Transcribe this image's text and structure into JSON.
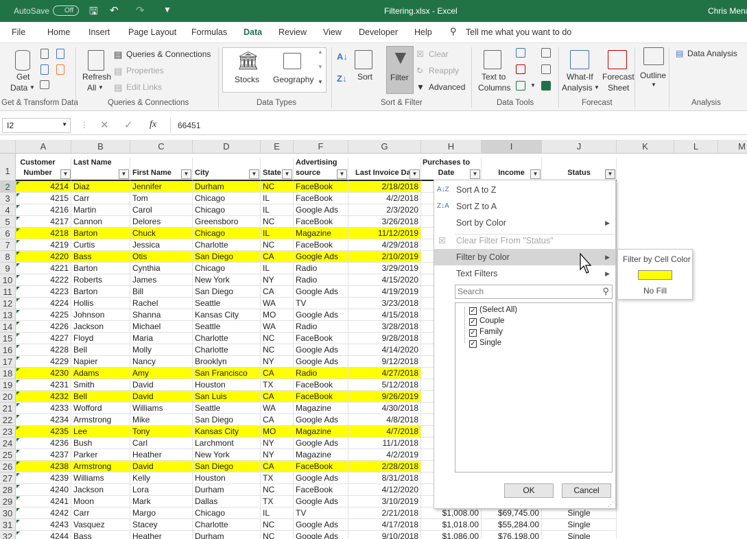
{
  "titlebar": {
    "autosave": "AutoSave",
    "autosave_state": "Off",
    "filename": "Filtering.xlsx  -  Excel",
    "user": "Chris Menard"
  },
  "tabs": [
    "File",
    "Home",
    "Insert",
    "Page Layout",
    "Formulas",
    "Data",
    "Review",
    "View",
    "Developer",
    "Help"
  ],
  "tell_me": "Tell me what you want to do",
  "ribbon": {
    "get_data": [
      "Get",
      "Data"
    ],
    "refresh": [
      "Refresh",
      "All"
    ],
    "queries_connections": "Queries & Connections",
    "properties": "Properties",
    "edit_links": "Edit Links",
    "stocks": "Stocks",
    "geography": "Geography",
    "sort": "Sort",
    "filter": "Filter",
    "clear": "Clear",
    "reapply": "Reapply",
    "advanced": "Advanced",
    "text_to_columns": [
      "Text to",
      "Columns"
    ],
    "what_if": [
      "What-If",
      "Analysis"
    ],
    "forecast_sheet": [
      "Forecast",
      "Sheet"
    ],
    "outline": "Outline",
    "data_analysis": "Data Analysis",
    "groups": [
      "Get & Transform Data",
      "Queries & Connections",
      "Data Types",
      "Sort & Filter",
      "Data Tools",
      "Forecast",
      "Analysis"
    ]
  },
  "formula_bar": {
    "name_box": "I2",
    "value": "66451"
  },
  "columns": [
    "A",
    "B",
    "C",
    "D",
    "E",
    "F",
    "G",
    "H",
    "I",
    "J",
    "K",
    "L",
    "M"
  ],
  "headers": {
    "A": [
      "Customer",
      "Number"
    ],
    "B": [
      "",
      "Last Name"
    ],
    "C": [
      "",
      "First Name"
    ],
    "D": [
      "",
      "City"
    ],
    "E": [
      "",
      "State"
    ],
    "F": [
      "Advertising",
      "source"
    ],
    "G": [
      "",
      "Last Invoice Dat"
    ],
    "H": [
      "Purchases to",
      "Date"
    ],
    "I": [
      "",
      "Income"
    ],
    "J": [
      "",
      "Status"
    ]
  },
  "rows": [
    {
      "n": "2",
      "hl": true,
      "a": "4214",
      "b": "Diaz",
      "c": "Jennifer",
      "d": "Durham",
      "e": "NC",
      "f": "FaceBook",
      "g": "2/18/2018"
    },
    {
      "n": "3",
      "hl": false,
      "a": "4215",
      "b": "Carr",
      "c": "Tom",
      "d": "Chicago",
      "e": "IL",
      "f": "FaceBook",
      "g": "4/2/2018"
    },
    {
      "n": "4",
      "hl": false,
      "a": "4216",
      "b": "Martin",
      "c": "Carol",
      "d": "Chicago",
      "e": "IL",
      "f": "Google Ads",
      "g": "2/3/2020"
    },
    {
      "n": "5",
      "hl": false,
      "a": "4217",
      "b": "Cannon",
      "c": "Delores",
      "d": "Greensboro",
      "e": "NC",
      "f": "FaceBook",
      "g": "3/26/2018"
    },
    {
      "n": "6",
      "hl": true,
      "a": "4218",
      "b": "Barton",
      "c": "Chuck",
      "d": "Chicago",
      "e": "IL",
      "f": "Magazine",
      "g": "11/12/2019"
    },
    {
      "n": "7",
      "hl": false,
      "a": "4219",
      "b": "Curtis",
      "c": "Jessica",
      "d": "Charlotte",
      "e": "NC",
      "f": "FaceBook",
      "g": "4/29/2018"
    },
    {
      "n": "8",
      "hl": true,
      "a": "4220",
      "b": "Bass",
      "c": "Otis",
      "d": "San Diego",
      "e": "CA",
      "f": "Google Ads",
      "g": "2/10/2019"
    },
    {
      "n": "9",
      "hl": false,
      "a": "4221",
      "b": "Barton",
      "c": "Cynthia",
      "d": "Chicago",
      "e": "IL",
      "f": "Radio",
      "g": "3/29/2019"
    },
    {
      "n": "10",
      "hl": false,
      "a": "4222",
      "b": "Roberts",
      "c": "James",
      "d": "New York",
      "e": "NY",
      "f": "Radio",
      "g": "4/15/2020"
    },
    {
      "n": "11",
      "hl": false,
      "a": "4223",
      "b": "Barton",
      "c": "Bill",
      "d": "San Diego",
      "e": "CA",
      "f": "Google Ads",
      "g": "4/19/2019"
    },
    {
      "n": "12",
      "hl": false,
      "a": "4224",
      "b": "Hollis",
      "c": "Rachel",
      "d": "Seattle",
      "e": "WA",
      "f": "TV",
      "g": "3/23/2018"
    },
    {
      "n": "13",
      "hl": false,
      "a": "4225",
      "b": "Johnson",
      "c": "Shanna",
      "d": "Kansas City",
      "e": "MO",
      "f": "Google Ads",
      "g": "4/15/2018"
    },
    {
      "n": "14",
      "hl": false,
      "a": "4226",
      "b": "Jackson",
      "c": "Michael",
      "d": "Seattle",
      "e": "WA",
      "f": "Radio",
      "g": "3/28/2018"
    },
    {
      "n": "15",
      "hl": false,
      "a": "4227",
      "b": "Floyd",
      "c": "Maria",
      "d": "Charlotte",
      "e": "NC",
      "f": "FaceBook",
      "g": "9/28/2018"
    },
    {
      "n": "16",
      "hl": false,
      "a": "4228",
      "b": "Bell",
      "c": "Molly",
      "d": "Charlotte",
      "e": "NC",
      "f": "Google Ads",
      "g": "4/14/2020"
    },
    {
      "n": "17",
      "hl": false,
      "a": "4229",
      "b": "Napier",
      "c": "Nancy",
      "d": "Brooklyn",
      "e": "NY",
      "f": "Google Ads",
      "g": "9/12/2018"
    },
    {
      "n": "18",
      "hl": true,
      "a": "4230",
      "b": "Adams",
      "c": "Amy",
      "d": "San Francisco",
      "e": "CA",
      "f": "Radio",
      "g": "4/27/2018"
    },
    {
      "n": "19",
      "hl": false,
      "a": "4231",
      "b": "Smith",
      "c": "David",
      "d": "Houston",
      "e": "TX",
      "f": "FaceBook",
      "g": "5/12/2018"
    },
    {
      "n": "20",
      "hl": true,
      "a": "4232",
      "b": "Bell",
      "c": "David",
      "d": "San Luis",
      "e": "CA",
      "f": "FaceBook",
      "g": "9/26/2019"
    },
    {
      "n": "21",
      "hl": false,
      "a": "4233",
      "b": "Wofford",
      "c": "Williams",
      "d": "Seattle",
      "e": "WA",
      "f": "Magazine",
      "g": "4/30/2018"
    },
    {
      "n": "22",
      "hl": false,
      "a": "4234",
      "b": "Armstrong",
      "c": "Mike",
      "d": "San Diego",
      "e": "CA",
      "f": "Google Ads",
      "g": "4/8/2018"
    },
    {
      "n": "23",
      "hl": true,
      "a": "4235",
      "b": "Lee",
      "c": "Tony",
      "d": "Kansas City",
      "e": "MO",
      "f": "Magazine",
      "g": "4/7/2018"
    },
    {
      "n": "24",
      "hl": false,
      "a": "4236",
      "b": "Bush",
      "c": "Carl",
      "d": "Larchmont",
      "e": "NY",
      "f": "Google Ads",
      "g": "11/1/2018"
    },
    {
      "n": "25",
      "hl": false,
      "a": "4237",
      "b": "Parker",
      "c": "Heather",
      "d": "New York",
      "e": "NY",
      "f": "Magazine",
      "g": "4/2/2019"
    },
    {
      "n": "26",
      "hl": true,
      "a": "4238",
      "b": "Armstrong",
      "c": "David",
      "d": "San Diego",
      "e": "CA",
      "f": "FaceBook",
      "g": "2/28/2018"
    },
    {
      "n": "27",
      "hl": false,
      "a": "4239",
      "b": "Williams",
      "c": "Kelly",
      "d": "Houston",
      "e": "TX",
      "f": "Google Ads",
      "g": "8/31/2018"
    },
    {
      "n": "28",
      "hl": false,
      "a": "4240",
      "b": "Jackson",
      "c": "Lora",
      "d": "Durham",
      "e": "NC",
      "f": "FaceBook",
      "g": "4/12/2020"
    },
    {
      "n": "29",
      "hl": false,
      "a": "4241",
      "b": "Moon",
      "c": "Mark",
      "d": "Dallas",
      "e": "TX",
      "f": "Google Ads",
      "g": "3/10/2019"
    },
    {
      "n": "30",
      "hl": false,
      "a": "4242",
      "b": "Carr",
      "c": "Margo",
      "d": "Chicago",
      "e": "IL",
      "f": "TV",
      "g": "2/21/2018",
      "h": "$1,008.00",
      "i": "$69,745.00",
      "j": "Single"
    },
    {
      "n": "31",
      "hl": false,
      "a": "4243",
      "b": "Vasquez",
      "c": "Stacey",
      "d": "Charlotte",
      "e": "NC",
      "f": "Google Ads",
      "g": "4/17/2018",
      "h": "$1,018.00",
      "i": "$55,284.00",
      "j": "Single"
    },
    {
      "n": "32",
      "hl": false,
      "a": "4244",
      "b": "Bass",
      "c": "Heather",
      "d": "Durham",
      "e": "NC",
      "f": "Google Ads",
      "g": "9/10/2018",
      "h": "$1,086.00",
      "i": "$76,198.00",
      "j": "Single"
    }
  ],
  "filter_menu": {
    "sort_az": "Sort A to Z",
    "sort_za": "Sort Z to A",
    "sort_by_color": "Sort by Color",
    "clear_filter": "Clear Filter From \"Status\"",
    "filter_by_color": "Filter by Color",
    "text_filters": "Text Filters",
    "search_placeholder": "Search",
    "items": [
      "(Select All)",
      "Couple",
      "Family",
      "Single"
    ],
    "ok": "OK",
    "cancel": "Cancel"
  },
  "color_submenu": {
    "title": "Filter by Cell Color",
    "swatch": "#ffff00",
    "no_fill": "No Fill"
  },
  "colors": {
    "excel_green": "#217346",
    "highlight": "#ffff00"
  }
}
